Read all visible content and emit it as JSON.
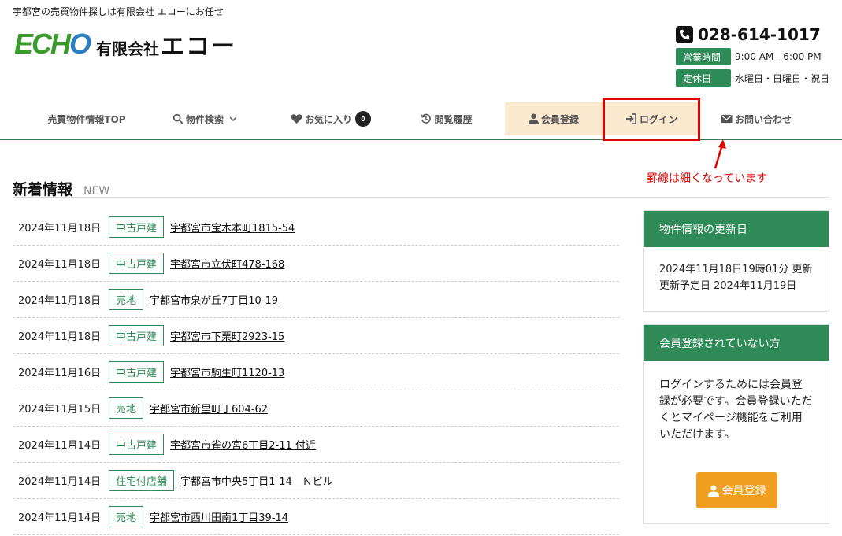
{
  "header": {
    "tagline": "宇都宮の売買物件探しは有限会社 エコーにお任せ",
    "logo_mark": "ECHO",
    "logo_company_type": "有限会社",
    "logo_company_name": "エコー",
    "phone": "028-614-1017",
    "hours_label": "営業時間",
    "hours_value": "9:00 AM - 6:00 PM",
    "holiday_label": "定休日",
    "holiday_value": "水曜日・日曜日・祝日"
  },
  "nav": {
    "items": [
      {
        "label": "売買物件情報TOP"
      },
      {
        "label": "物件検索"
      },
      {
        "label": "お気に入り",
        "count": "0"
      },
      {
        "label": "閲覧履歴"
      },
      {
        "label": "会員登録"
      },
      {
        "label": "ログイン"
      },
      {
        "label": "お問い合わせ"
      }
    ]
  },
  "annotation": {
    "note": "罫線は細くなっています",
    "color": "#e00000"
  },
  "news": {
    "title": "新着情報",
    "title_en": "NEW",
    "items": [
      {
        "date": "2024年11月18日",
        "tag": "中古戸建",
        "text": "宇都宮市宝木本町1815-54 "
      },
      {
        "date": "2024年11月18日",
        "tag": "中古戸建",
        "text": "宇都宮市立伏町478-168 "
      },
      {
        "date": "2024年11月18日",
        "tag": "売地",
        "text": "宇都宮市泉が丘7丁目10-19 "
      },
      {
        "date": "2024年11月18日",
        "tag": "中古戸建",
        "text": "宇都宮市下栗町2923-15 "
      },
      {
        "date": "2024年11月16日",
        "tag": "中古戸建",
        "text": "宇都宮市駒生町1120-13 "
      },
      {
        "date": "2024年11月15日",
        "tag": "売地",
        "text": "宇都宮市新里町丁604-62 "
      },
      {
        "date": "2024年11月14日",
        "tag": "中古戸建",
        "text": "宇都宮市雀の宮6丁目2-11 付近 "
      },
      {
        "date": "2024年11月14日",
        "tag": "住宅付店舗",
        "text": "宇都宮市中央5丁目1-14　Ｎビル"
      },
      {
        "date": "2024年11月14日",
        "tag": "売地",
        "text": "宇都宮市西川田南1丁目39-14 "
      }
    ]
  },
  "sidebar": {
    "update_title": "物件情報の更新日",
    "update_line1": "2024年11月18日19時01分 更新",
    "update_line2": "更新予定日 2024年11月19日",
    "member_title": "会員登録されていない方",
    "member_text": "ログインするためには会員登録が必要です。会員登録いただくとマイページ機能をご利用いただけます。",
    "member_button": "会員登録"
  },
  "colors": {
    "brand_green": "#2e8b57",
    "accent_orange": "#f0a020",
    "nav_highlight": "#fbe9cf"
  }
}
